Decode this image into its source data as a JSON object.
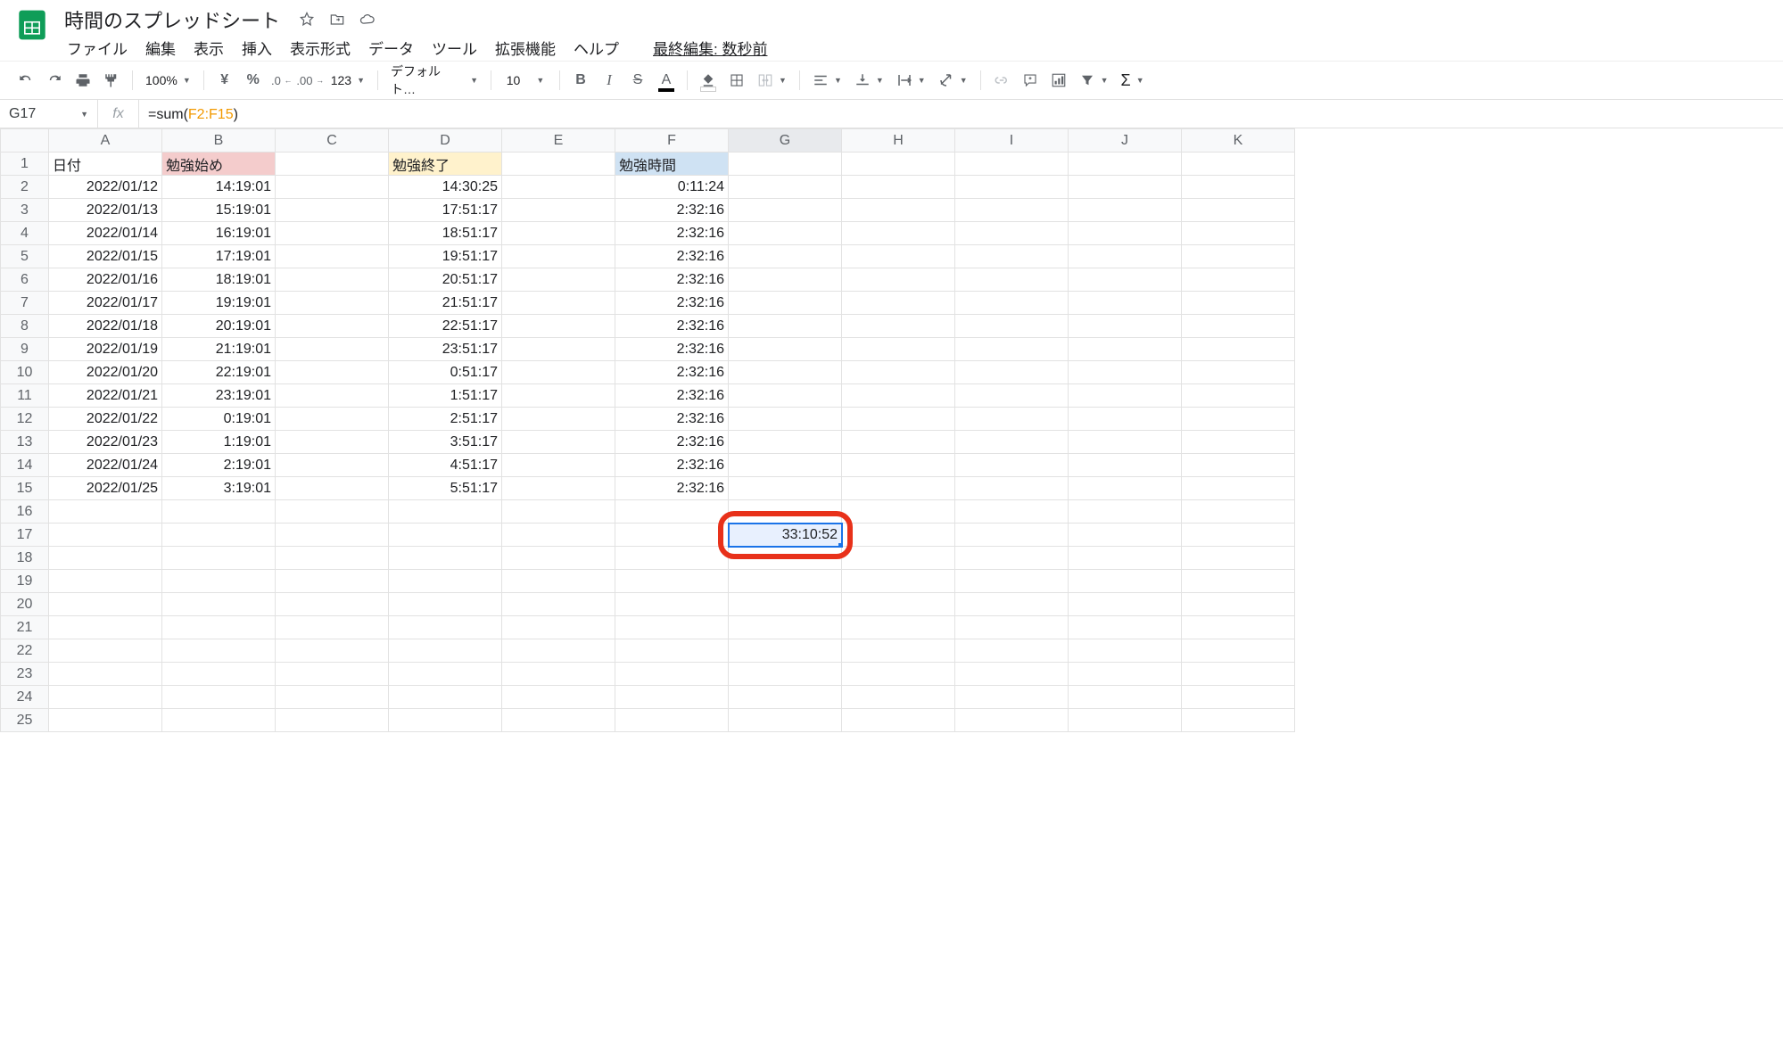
{
  "doc_title": "時間のスプレッドシート",
  "menus": {
    "file": "ファイル",
    "edit": "編集",
    "view": "表示",
    "insert": "挿入",
    "format": "表示形式",
    "data": "データ",
    "tools": "ツール",
    "ext": "拡張機能",
    "help": "ヘルプ"
  },
  "last_edit": "最終編集: 数秒前",
  "toolbar": {
    "zoom": "100%",
    "font": "デフォルト…",
    "size": "10",
    "yen": "¥",
    "percent": "%",
    "dec_dec": ".0",
    "inc_dec": ".00",
    "num123": "123"
  },
  "namebox": "G17",
  "formula": {
    "prefix": "=sum(",
    "range": "F2:F15",
    "suffix": ")"
  },
  "fx_label": "fx",
  "columns": [
    "A",
    "B",
    "C",
    "D",
    "E",
    "F",
    "G",
    "H",
    "I",
    "J",
    "K"
  ],
  "row_count": 25,
  "headers": {
    "A": "日付",
    "B": "勉強始め",
    "D": "勉強終了",
    "F": "勉強時間"
  },
  "rows": [
    {
      "A": "2022/01/12",
      "B": "14:19:01",
      "D": "14:30:25",
      "F": "0:11:24"
    },
    {
      "A": "2022/01/13",
      "B": "15:19:01",
      "D": "17:51:17",
      "F": "2:32:16"
    },
    {
      "A": "2022/01/14",
      "B": "16:19:01",
      "D": "18:51:17",
      "F": "2:32:16"
    },
    {
      "A": "2022/01/15",
      "B": "17:19:01",
      "D": "19:51:17",
      "F": "2:32:16"
    },
    {
      "A": "2022/01/16",
      "B": "18:19:01",
      "D": "20:51:17",
      "F": "2:32:16"
    },
    {
      "A": "2022/01/17",
      "B": "19:19:01",
      "D": "21:51:17",
      "F": "2:32:16"
    },
    {
      "A": "2022/01/18",
      "B": "20:19:01",
      "D": "22:51:17",
      "F": "2:32:16"
    },
    {
      "A": "2022/01/19",
      "B": "21:19:01",
      "D": "23:51:17",
      "F": "2:32:16"
    },
    {
      "A": "2022/01/20",
      "B": "22:19:01",
      "D": "0:51:17",
      "F": "2:32:16"
    },
    {
      "A": "2022/01/21",
      "B": "23:19:01",
      "D": "1:51:17",
      "F": "2:32:16"
    },
    {
      "A": "2022/01/22",
      "B": "0:19:01",
      "D": "2:51:17",
      "F": "2:32:16"
    },
    {
      "A": "2022/01/23",
      "B": "1:19:01",
      "D": "3:51:17",
      "F": "2:32:16"
    },
    {
      "A": "2022/01/24",
      "B": "2:19:01",
      "D": "4:51:17",
      "F": "2:32:16"
    },
    {
      "A": "2022/01/25",
      "B": "3:19:01",
      "D": "5:51:17",
      "F": "2:32:16"
    }
  ],
  "selected": {
    "r": 17,
    "c": "G",
    "value": "33:10:52"
  }
}
